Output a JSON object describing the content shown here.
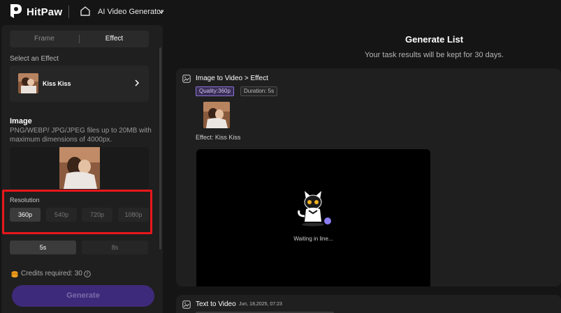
{
  "app": {
    "logo_name": "HitPaw",
    "title": "AI Video Generator",
    "icons": {
      "home": "home-icon",
      "dropdown": "chevron-down-icon"
    }
  },
  "left_panel": {
    "tabs": [
      {
        "label": "Frame",
        "active": false
      },
      {
        "label": "Effect",
        "active": true
      }
    ],
    "select_effect_label": "Select an Effect",
    "effect": {
      "name": "Kiss Kiss"
    },
    "image": {
      "title": "Image",
      "description": "PNG/WEBP/ JPG/JPEG files up to 20MB with maximum dimensions of 4000px."
    },
    "resolution": {
      "title": "Resolution",
      "options": [
        {
          "label": "360p",
          "selected": true
        },
        {
          "label": "540p",
          "selected": false
        },
        {
          "label": "720p",
          "selected": false
        },
        {
          "label": "1080p",
          "selected": false
        }
      ],
      "highlight_color": "#e8171b"
    },
    "duration": {
      "options": [
        {
          "label": "5s",
          "selected": true
        },
        {
          "label": "8s",
          "selected": false
        }
      ]
    },
    "credits_text": "Credits required: 30",
    "generate_label": "Generate",
    "generate_color": "#3e2a7a"
  },
  "generate_list": {
    "title": "Generate List",
    "subtitle": "Your task results will be kept for 30 days.",
    "tasks": [
      {
        "title": "Image to Video > Effect",
        "quality_tag": "Quality:360p",
        "duration_tag": "Duration: 5s",
        "effect_label": "Effect: Kiss Kiss",
        "status": "Waiting in line..."
      },
      {
        "title": "Text to Video",
        "date": "Jun, 18,2025, 07:23"
      }
    ]
  }
}
